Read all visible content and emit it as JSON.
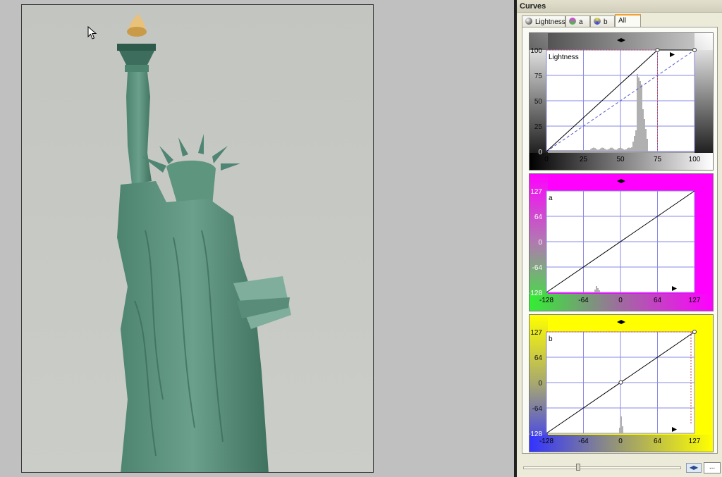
{
  "panel": {
    "title": "Curves"
  },
  "tabs": [
    {
      "label": "Lightness",
      "icon": "lightness-channel-icon"
    },
    {
      "label": "a",
      "icon": "a-channel-icon"
    },
    {
      "label": "b",
      "icon": "b-channel-icon"
    },
    {
      "label": "All",
      "active": true
    }
  ],
  "curves": {
    "lightness": {
      "channel_label": "Lightness",
      "y_ticks": [
        "100",
        "75",
        "50",
        "25",
        "0"
      ],
      "x_ticks": [
        "0",
        "25",
        "50",
        "75",
        "100"
      ],
      "curve_points": [
        [
          0,
          0
        ],
        [
          75,
          100
        ],
        [
          100,
          100
        ]
      ],
      "tick_color": "#111111"
    },
    "a": {
      "channel_label": "a",
      "y_ticks": [
        "127",
        "64",
        "0",
        "-64",
        "-128"
      ],
      "x_ticks": [
        "-128",
        "-64",
        "0",
        "64",
        "127"
      ],
      "curve_points": [
        [
          -128,
          -128
        ],
        [
          127,
          127
        ]
      ],
      "tick_color": "#ffffff"
    },
    "b": {
      "channel_label": "b",
      "y_ticks": [
        "127",
        "64",
        "0",
        "-64",
        "-128"
      ],
      "x_ticks": [
        "-128",
        "-64",
        "0",
        "64",
        "127"
      ],
      "curve_points": [
        [
          -128,
          -128
        ],
        [
          0,
          0
        ],
        [
          127,
          127
        ]
      ],
      "tick_color": "#111111"
    }
  },
  "footer": {
    "more_label": "..."
  },
  "colors": {
    "grid": "#8a8ae6",
    "curve": "#000000",
    "a_gradient": [
      "#33ee33",
      "#ff00ff"
    ],
    "b_gradient": [
      "#3333ff",
      "#ffff00"
    ]
  }
}
